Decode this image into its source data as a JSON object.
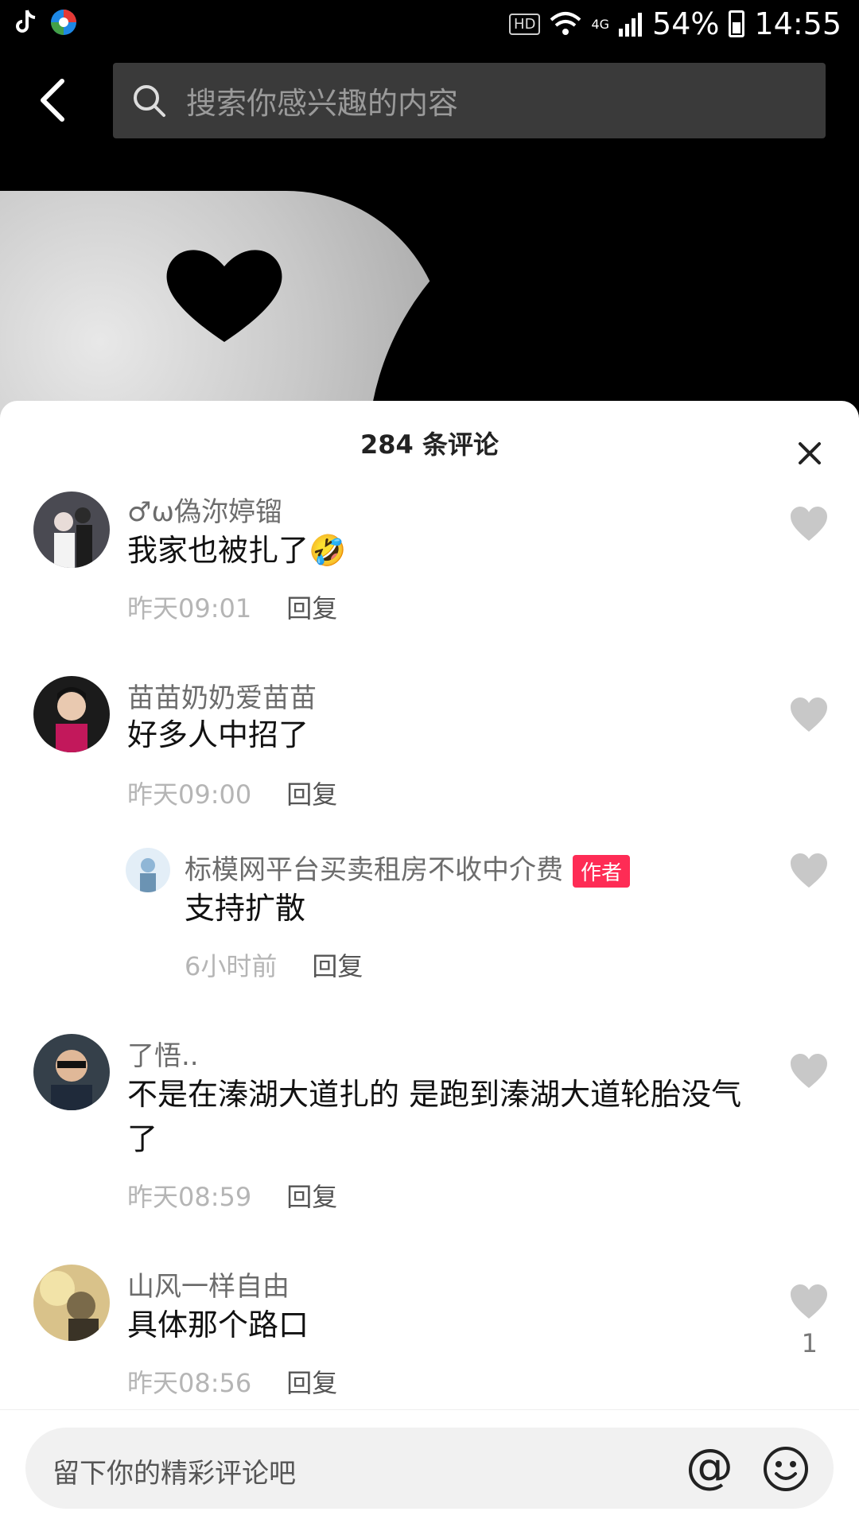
{
  "status_bar": {
    "hd": "HD",
    "network": "4G",
    "battery": "54%",
    "time": "14:55"
  },
  "search": {
    "placeholder": "搜索你感兴趣的内容"
  },
  "comments_panel": {
    "title": "284 条评论",
    "reply_label": "回复",
    "comments": [
      {
        "user": "♂ω偽沵婷镏",
        "text": "我家也被扎了",
        "emoji": "🤣",
        "time": "昨天09:01"
      },
      {
        "user": "苗苗奶奶爱苗苗",
        "text": "好多人中招了",
        "time": "昨天09:00"
      },
      {
        "user": "标模网平台买卖租房不收中介费",
        "badge": "作者",
        "text": "支持扩散",
        "time": "6小时前"
      },
      {
        "user": "了悟..",
        "text": "不是在溱湖大道扎的 是跑到溱湖大道轮胎没气了",
        "time": "昨天08:59"
      },
      {
        "user": "山风一样自由",
        "text": "具体那个路口",
        "time": "昨天08:56",
        "likes": "1"
      }
    ]
  },
  "input": {
    "placeholder": "留下你的精彩评论吧",
    "at_symbol": "@"
  }
}
